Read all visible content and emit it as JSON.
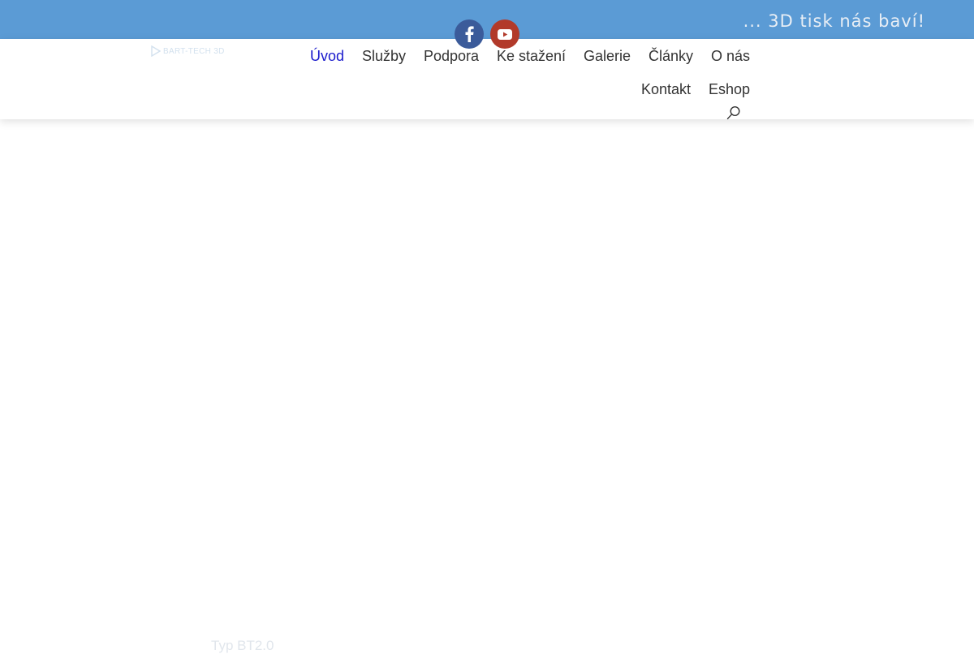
{
  "topbar": {
    "tagline": "... 3D tisk nás baví!",
    "color": "#5b9bd5"
  },
  "social": [
    {
      "name": "facebook",
      "icon": "facebook-icon",
      "color": "#3b5b9a"
    },
    {
      "name": "youtube",
      "icon": "youtube-icon",
      "color": "#b23a2a"
    }
  ],
  "header": {
    "logo_text": "BART-TECH 3D",
    "nav": [
      {
        "label": "Úvod",
        "active": true
      },
      {
        "label": "Služby",
        "active": false
      },
      {
        "label": "Podpora",
        "active": false
      },
      {
        "label": "Ke stažení",
        "active": false
      },
      {
        "label": "Galerie",
        "active": false
      },
      {
        "label": "Články",
        "active": false
      },
      {
        "label": "O nás",
        "active": false
      },
      {
        "label": "Kontakt",
        "active": false
      },
      {
        "label": "Eshop",
        "active": false
      }
    ],
    "active_color": "#1a1acc",
    "search_icon": "search-icon"
  },
  "hero": {
    "caption": "Typ BT2.0"
  }
}
